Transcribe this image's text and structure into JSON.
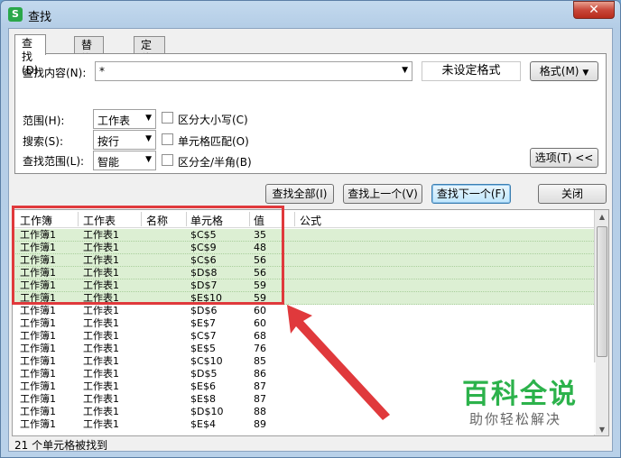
{
  "window": {
    "title": "查找",
    "app_icon": "S",
    "close_label": "✕"
  },
  "tabs": [
    {
      "label": "查找(D)"
    },
    {
      "label": "替换(P)"
    },
    {
      "label": "定位(G)"
    }
  ],
  "search": {
    "label": "查找内容(N):",
    "value": "*",
    "format_status": "未设定格式",
    "format_button": "格式(M)"
  },
  "options": {
    "scope_label": "范围(H):",
    "scope_value": "工作表",
    "search_label": "搜索(S):",
    "search_value": "按行",
    "range_label": "查找范围(L):",
    "range_value": "智能",
    "match_case": "区分大小写(C)",
    "match_cell": "单元格匹配(O)",
    "match_width": "区分全/半角(B)",
    "options_button": "选项(T) <<"
  },
  "actions": {
    "find_all": "查找全部(I)",
    "find_prev": "查找上一个(V)",
    "find_next": "查找下一个(F)",
    "close": "关闭"
  },
  "results": {
    "columns": [
      "工作簿",
      "工作表",
      "名称",
      "单元格",
      "值",
      "公式"
    ],
    "rows": [
      {
        "book": "工作簿1",
        "sheet": "工作表1",
        "cell": "$C$5",
        "value": "35",
        "selected": true
      },
      {
        "book": "工作簿1",
        "sheet": "工作表1",
        "cell": "$C$9",
        "value": "48",
        "selected": true
      },
      {
        "book": "工作簿1",
        "sheet": "工作表1",
        "cell": "$C$6",
        "value": "56",
        "selected": true
      },
      {
        "book": "工作簿1",
        "sheet": "工作表1",
        "cell": "$D$8",
        "value": "56",
        "selected": true
      },
      {
        "book": "工作簿1",
        "sheet": "工作表1",
        "cell": "$D$7",
        "value": "59",
        "selected": true
      },
      {
        "book": "工作簿1",
        "sheet": "工作表1",
        "cell": "$E$10",
        "value": "59",
        "selected": true
      },
      {
        "book": "工作簿1",
        "sheet": "工作表1",
        "cell": "$D$6",
        "value": "60",
        "selected": false
      },
      {
        "book": "工作簿1",
        "sheet": "工作表1",
        "cell": "$E$7",
        "value": "60",
        "selected": false
      },
      {
        "book": "工作簿1",
        "sheet": "工作表1",
        "cell": "$C$7",
        "value": "68",
        "selected": false
      },
      {
        "book": "工作簿1",
        "sheet": "工作表1",
        "cell": "$E$5",
        "value": "76",
        "selected": false
      },
      {
        "book": "工作簿1",
        "sheet": "工作表1",
        "cell": "$C$10",
        "value": "85",
        "selected": false
      },
      {
        "book": "工作簿1",
        "sheet": "工作表1",
        "cell": "$D$5",
        "value": "86",
        "selected": false
      },
      {
        "book": "工作簿1",
        "sheet": "工作表1",
        "cell": "$E$6",
        "value": "87",
        "selected": false
      },
      {
        "book": "工作簿1",
        "sheet": "工作表1",
        "cell": "$E$8",
        "value": "87",
        "selected": false
      },
      {
        "book": "工作簿1",
        "sheet": "工作表1",
        "cell": "$D$10",
        "value": "88",
        "selected": false
      },
      {
        "book": "工作簿1",
        "sheet": "工作表1",
        "cell": "$E$4",
        "value": "89",
        "selected": false
      }
    ],
    "status": "21 个单元格被找到"
  },
  "watermark": {
    "main": "百科全说",
    "sub": "助你轻松解决"
  },
  "colors": {
    "highlight_border": "#e0393c",
    "selected_row": "#dcefd3",
    "watermark": "#2cb24b"
  }
}
